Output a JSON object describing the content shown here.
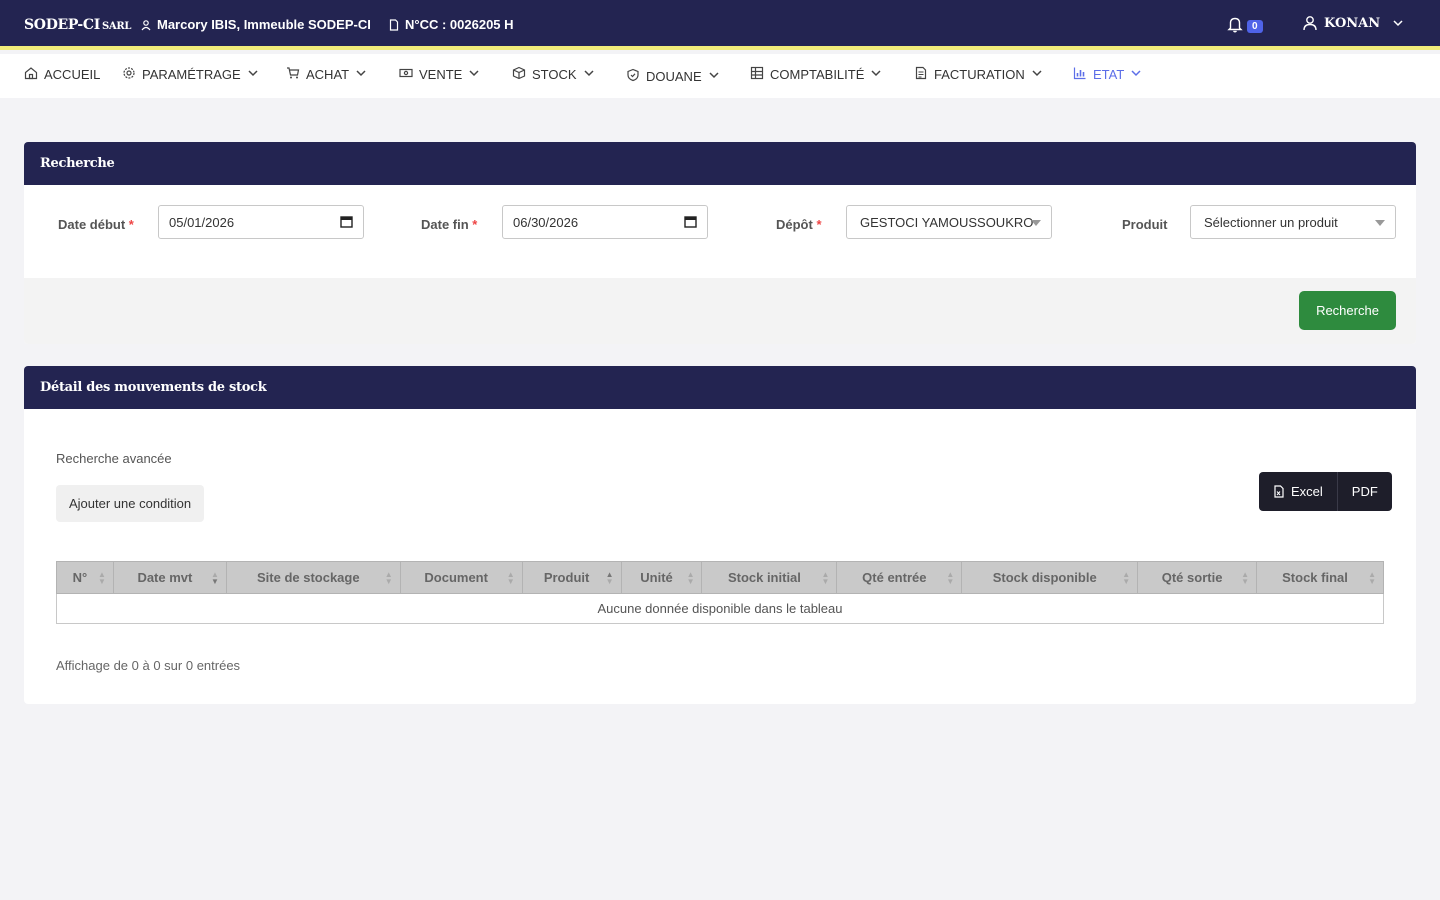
{
  "topbar": {
    "brand": "SODEP-CI",
    "brand_sub": "SARL",
    "address": "Marcory IBIS, Immeuble SODEP-CI",
    "ncc": "N°CC : 0026205 H",
    "notification_count": "0",
    "user": "KONAN"
  },
  "nav": {
    "items": [
      {
        "label": "ACCUEIL",
        "icon": "home-icon"
      },
      {
        "label": "PARAMÉTRAGE",
        "icon": "gear-icon"
      },
      {
        "label": "ACHAT",
        "icon": "cart-icon"
      },
      {
        "label": "VENTE",
        "icon": "cash-icon"
      },
      {
        "label": "STOCK",
        "icon": "box-icon"
      },
      {
        "label": "DOUANE",
        "icon": "shield-icon"
      },
      {
        "label": "COMPTABILITÉ",
        "icon": "grid-icon"
      },
      {
        "label": "FACTURATION",
        "icon": "invoice-icon"
      },
      {
        "label": "ETAT",
        "icon": "chart-icon",
        "active": true
      }
    ]
  },
  "search_card": {
    "title": "Recherche",
    "date_debut_label": "Date début",
    "date_debut_value": "05/01/2026",
    "date_fin_label": "Date fin",
    "date_fin_value": "06/30/2026",
    "depot_label": "Dépôt",
    "depot_value": "GESTOCI YAMOUSSOUKRO",
    "produit_label": "Produit",
    "produit_placeholder": "Sélectionner un produit",
    "required_mark": "*",
    "search_button": "Recherche"
  },
  "detail_card": {
    "title": "Détail des mouvements de stock",
    "advanced_search_label": "Recherche avancée",
    "add_condition_button": "Ajouter une condition",
    "excel_button": "Excel",
    "pdf_button": "PDF",
    "columns": [
      "N°",
      "Date mvt",
      "Site de stockage",
      "Document",
      "Produit",
      "Unité",
      "Stock initial",
      "Qté entrée",
      "Stock disponible",
      "Qté sortie",
      "Stock final"
    ],
    "empty_message": "Aucune donnée disponible dans le tableau",
    "info": "Affichage de 0 à 0 sur 0 entrées"
  },
  "colors": {
    "header": "#232451",
    "accent_line": "#f1ec7a",
    "active_nav": "#5c6ee8",
    "search_button": "#2e8b3e"
  }
}
